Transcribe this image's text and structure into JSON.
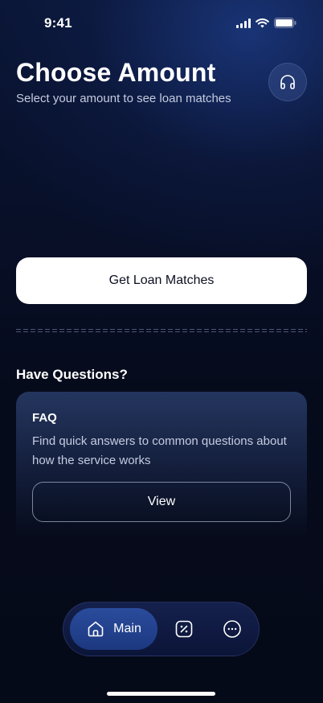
{
  "status_bar": {
    "time": "9:41"
  },
  "header": {
    "title": "Choose Amount",
    "subtitle": "Select your amount to see loan matches",
    "support_icon": "headphones-icon"
  },
  "primary_action": {
    "label": "Get Loan Matches"
  },
  "questions": {
    "section_title": "Have Questions?",
    "faq": {
      "title": "FAQ",
      "description": "Find quick answers to common questions about how the service works",
      "button_label": "View"
    }
  },
  "tabbar": {
    "items": [
      {
        "label": "Main",
        "icon": "home-icon",
        "active": true
      },
      {
        "label": "",
        "icon": "percent-icon",
        "active": false
      },
      {
        "label": "",
        "icon": "more-icon",
        "active": false
      }
    ]
  },
  "colors": {
    "background": "#060b1b",
    "accent": "#2a4c9c",
    "text_secondary": "#c5cbe0"
  }
}
